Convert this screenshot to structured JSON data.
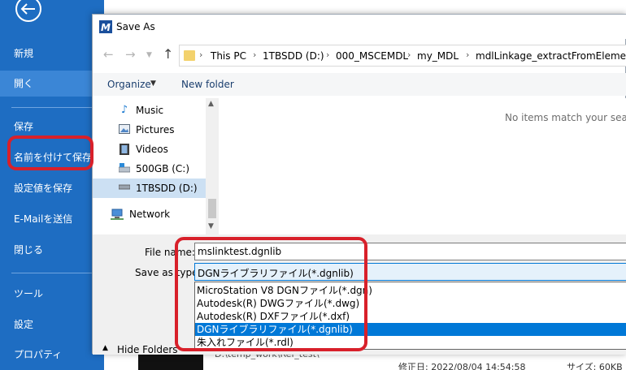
{
  "sidebar": {
    "back_icon": "back-arrow-icon",
    "items": [
      {
        "label": "新規"
      },
      {
        "label": "開く"
      },
      {
        "label": "保存"
      },
      {
        "label": "名前を付けて保存"
      },
      {
        "label": "設定値を保存"
      },
      {
        "label": "E-Mailを送信"
      },
      {
        "label": "閉じる"
      },
      {
        "label": "ツール"
      },
      {
        "label": "設定"
      },
      {
        "label": "プロパティ"
      }
    ],
    "active_index": 1
  },
  "background": {
    "path_text": "D:\\temp_work\\Ref_test\\",
    "modified": "修正日: 2022/08/04 14:54:58",
    "size": "サイズ: 60KB"
  },
  "dialog": {
    "title": "Save As",
    "address_crumbs": [
      "This PC",
      "1TBSDD (D:)",
      "000_MSCEMDL",
      "my_MDL",
      "mdlLinkage_extractFromElement"
    ],
    "toolbar": {
      "organize": "Organize",
      "new_folder": "New folder"
    },
    "nav_tree": [
      {
        "label": "Music",
        "icon": "music-icon"
      },
      {
        "label": "Pictures",
        "icon": "pictures-icon"
      },
      {
        "label": "Videos",
        "icon": "videos-icon"
      },
      {
        "label": "500GB (C:)",
        "icon": "drive-c-icon"
      },
      {
        "label": "1TBSDD (D:)",
        "icon": "drive-d-icon",
        "selected": true
      },
      {
        "label": "Network",
        "icon": "network-icon"
      }
    ],
    "empty_message": "No items match your search.",
    "file_name_label": "File name:",
    "file_name_value": "mslinktest.dgnlib",
    "save_as_type_label": "Save as type:",
    "save_as_type_value": "DGNライブラリファイル(*.dgnlib)",
    "type_options": [
      "MicroStation V8 DGNファイル(*.dgn)",
      "Autodesk(R) DWGファイル(*.dwg)",
      "Autodesk(R) DXFファイル(*.dxf)",
      "DGNライブラリファイル(*.dgnlib)",
      "朱入れファイル(*.rdl)"
    ],
    "selected_option_index": 3,
    "hide_folders": "Hide Folders"
  },
  "colors": {
    "sidebar_bg": "#1e6dc2",
    "highlight_red": "#d8202a",
    "selection_blue": "#0078d7"
  }
}
